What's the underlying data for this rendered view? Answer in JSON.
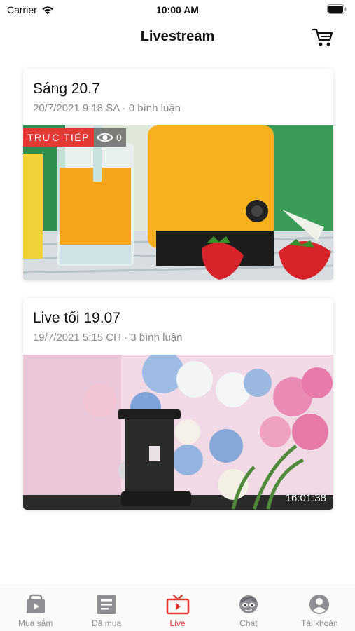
{
  "status_bar": {
    "carrier": "Carrier",
    "time": "10:00 AM"
  },
  "nav": {
    "title": "Livestream",
    "cart_icon": "cart-icon"
  },
  "streams": [
    {
      "title": "Sáng 20.7",
      "meta": "20/7/2021 9:18 SA · 0 bình luận",
      "live_label": "TRỰC TIẾP",
      "viewers": "0",
      "thumbnail": "orange juice, yellow juicer and strawberries"
    },
    {
      "title": "Live tối 19.07",
      "meta": "19/7/2021 5:15 CH · 3 bình luận",
      "duration": "16:01:38",
      "thumbnail": "blue and pink flowers with a black juicer"
    }
  ],
  "tabs": [
    {
      "label": "Mua sắm",
      "icon": "shopping-video-icon",
      "active": false
    },
    {
      "label": "Đã mua",
      "icon": "document-icon",
      "active": false
    },
    {
      "label": "Live",
      "icon": "tv-live-icon",
      "active": true
    },
    {
      "label": "Chat",
      "icon": "chat-face-icon",
      "active": false
    },
    {
      "label": "Tài khoản",
      "icon": "account-icon",
      "active": false
    }
  ],
  "colors": {
    "accent": "#e23b36",
    "inactive_tab": "#8e8e93",
    "meta_text": "#8a8a8a"
  }
}
